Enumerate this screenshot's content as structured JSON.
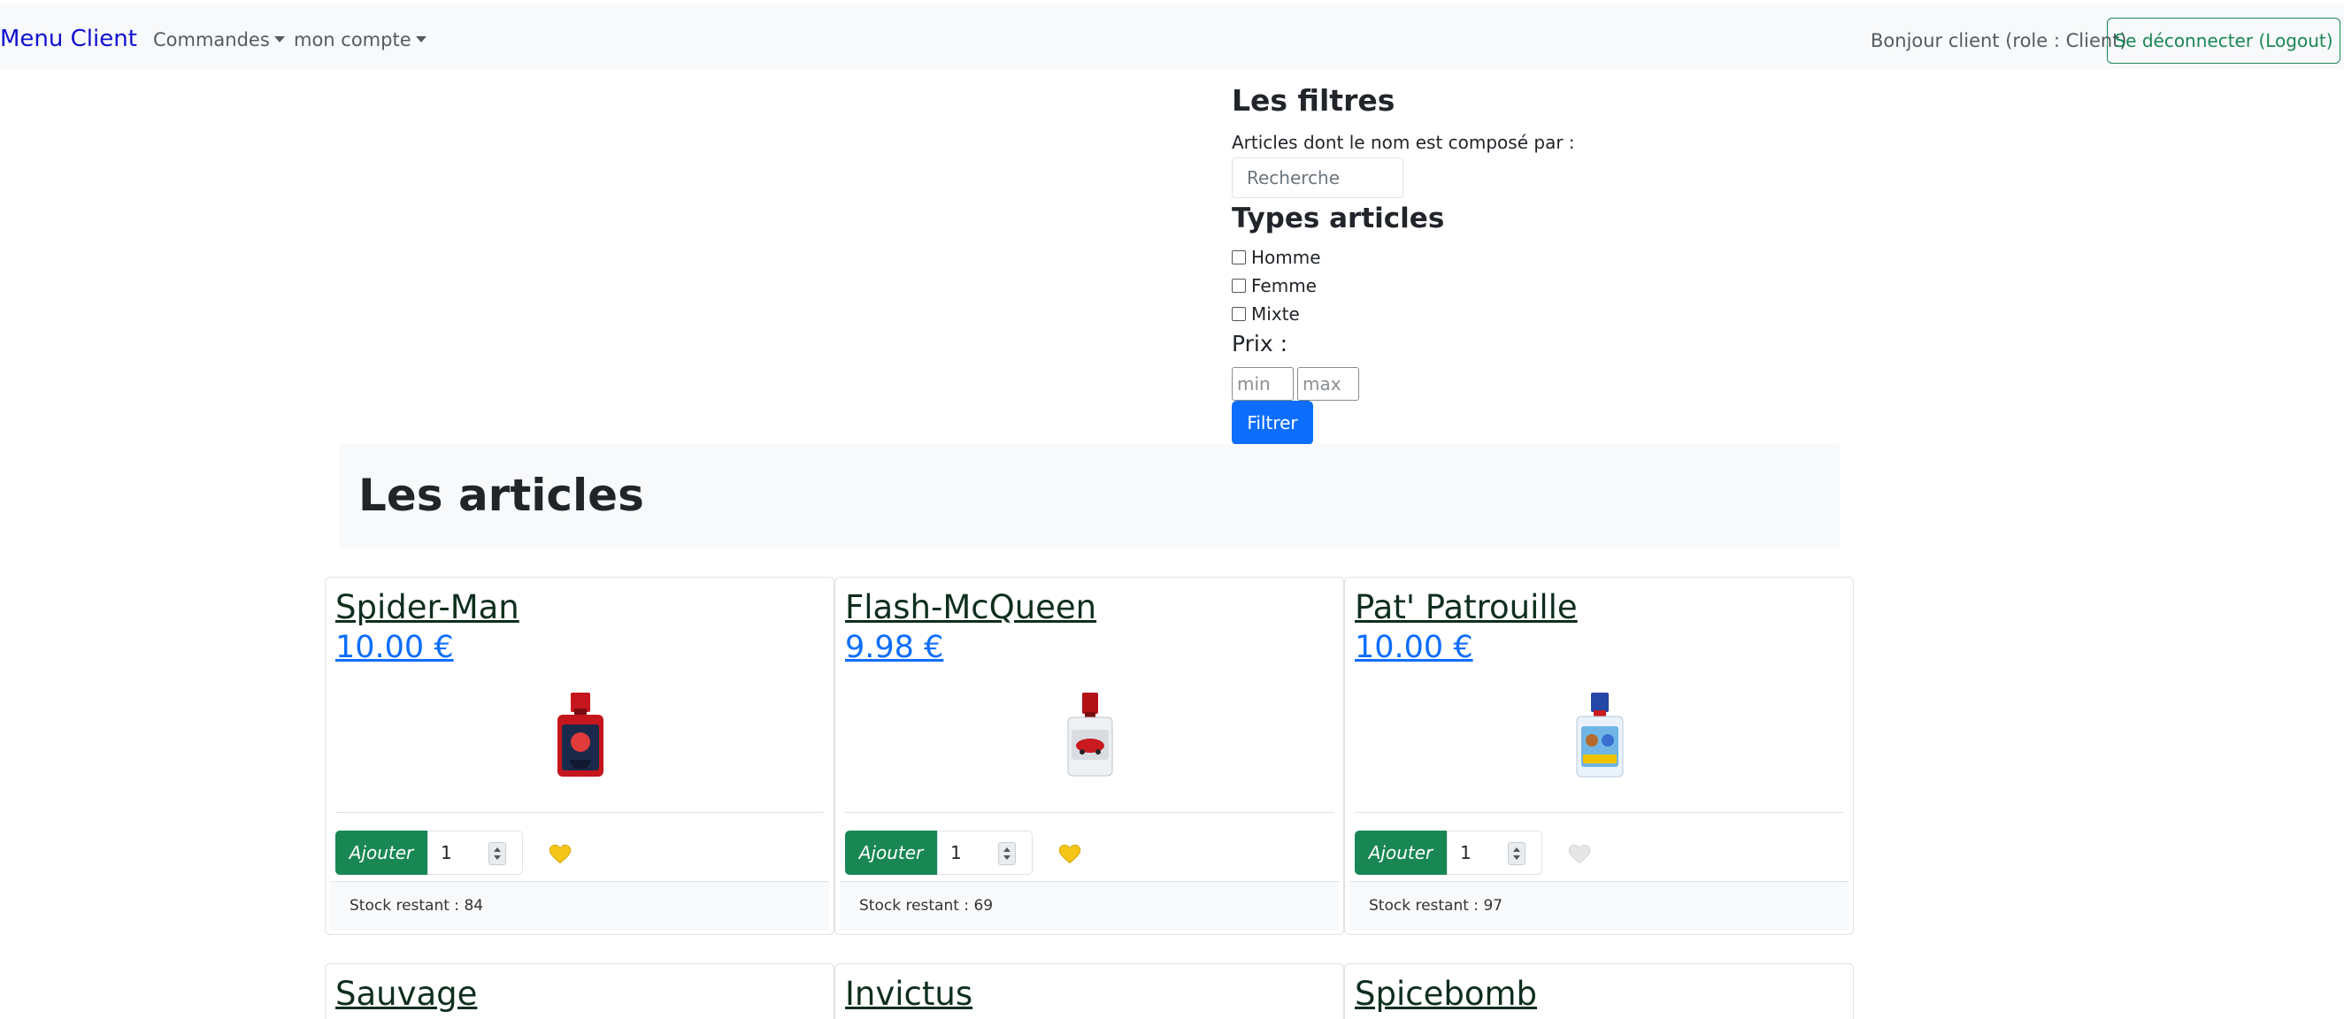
{
  "navbar": {
    "brand": "Menu Client",
    "menu_orders": "Commandes",
    "menu_account": "mon compte",
    "greeting": "Bonjour client (role : Client)",
    "logout_label": "Se déconnecter (Logout)"
  },
  "filters": {
    "title": "Les filtres",
    "name_label": "Articles dont le nom est composé par :",
    "search_placeholder": "Recherche",
    "search_value": "",
    "types_title": "Types articles",
    "types": [
      {
        "label": "Homme",
        "checked": false
      },
      {
        "label": "Femme",
        "checked": false
      },
      {
        "label": "Mixte",
        "checked": false
      }
    ],
    "price_label": "Prix :",
    "min_placeholder": "min",
    "max_placeholder": "max",
    "filter_button": "Filtrer"
  },
  "articles": {
    "title": "Les articles",
    "add_label": "Ajouter",
    "items": [
      {
        "name": "Spider-Man",
        "price": "10.00 €",
        "quantity": "1",
        "favorite": true,
        "stock": "Stock restant : 84",
        "bottle_color": "#c4161c",
        "label_color": "#1b2a4a"
      },
      {
        "name": "Flash-McQueen",
        "price": "9.98 €",
        "quantity": "1",
        "favorite": true,
        "stock": "Stock restant : 69",
        "bottle_color": "#b31217",
        "label_color": "#d9dde2"
      },
      {
        "name": "Pat' Patrouille",
        "price": "10.00 €",
        "quantity": "1",
        "favorite": false,
        "stock": "Stock restant : 97",
        "bottle_color": "#2446a6",
        "label_color": "#6fb6e6"
      },
      {
        "name": "Sauvage"
      },
      {
        "name": "Invictus"
      },
      {
        "name": "Spicebomb"
      }
    ]
  },
  "colors": {
    "heart_favorite": "#f5c518",
    "heart_not_favorite": "#e6e6e6"
  }
}
